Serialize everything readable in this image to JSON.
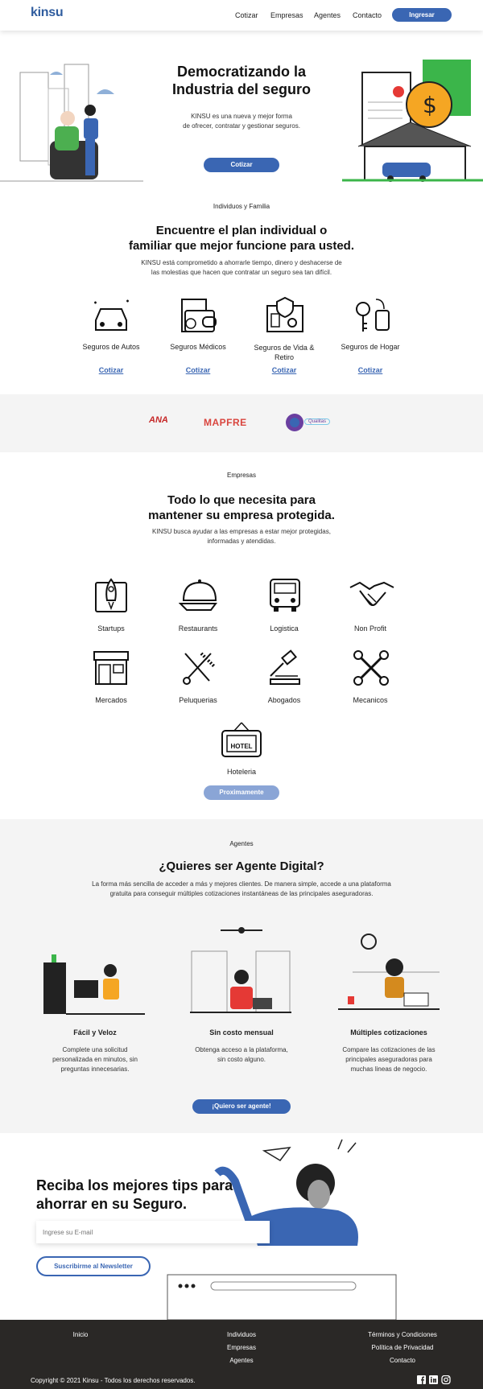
{
  "nav": {
    "logo": "kinsu",
    "links": [
      "Cotizar",
      "Empresas",
      "Agentes",
      "Contacto"
    ],
    "login": "Ingresar"
  },
  "hero": {
    "title_line1": "Democratizando la",
    "title_line2": "Industria del seguro",
    "text_line1": "KINSU es una nueva y mejor forma",
    "text_line2": "de ofrecer, contratar y gestionar seguros.",
    "cta": "Cotizar"
  },
  "individuals": {
    "eyebrow": "Individuos y Familia",
    "title_line1": "Encuentre el plan individual o",
    "title_line2": "familiar que mejor funcione para usted.",
    "text_line1": "KINSU está comprometido a ahorrarle tiempo, dinero y deshacerse de",
    "text_line2": "las molestias que hacen que contratar un seguro sea tan difícil.",
    "items": [
      {
        "label": "Seguros de Autos",
        "link": "Cotizar"
      },
      {
        "label": "Seguros Médicos",
        "link": "Cotizar"
      },
      {
        "label_line1": "Seguros de Vida &",
        "label_line2": "Retiro",
        "link": "Cotizar"
      },
      {
        "label": "Seguros de Hogar",
        "link": "Cotizar"
      }
    ]
  },
  "partners": [
    "ANA",
    "MAPFRE",
    "Qualitas"
  ],
  "business": {
    "eyebrow": "Empresas",
    "title_line1": "Todo lo que necesita para",
    "title_line2": "mantener su empresa protegida.",
    "text_line1": "KINSU busca ayudar a las empresas a estar mejor protegidas,",
    "text_line2": "informadas y atendidas.",
    "items": [
      "Startups",
      "Restaurants",
      "Logistica",
      "Non Profit",
      "Mercados",
      "Peluquerias",
      "Abogados",
      "Mecanicos",
      "Hoteleria"
    ],
    "hotel_sign": "HOTEL",
    "cta": "Proximamente"
  },
  "agents": {
    "eyebrow": "Agentes",
    "title": "¿Quieres ser Agente Digital?",
    "text_line1": "La forma más sencilla de acceder a más y mejores clientes. De manera simple, accede a una plataforma",
    "text_line2": "gratuita para conseguir múltiples cotizaciones instantáneas de las principales aseguradoras.",
    "features": [
      {
        "title": "Fácil y Veloz",
        "l1": "Complete una solicitud",
        "l2": "personalizada en minutos, sin",
        "l3": "preguntas innecesarias."
      },
      {
        "title": "Sin costo mensual",
        "l1": "Obtenga acceso a la plataforma,",
        "l2": "sin costo alguno.",
        "l3": ""
      },
      {
        "title": "Múltiples cotizaciones",
        "l1": "Compare las cotizaciones de las",
        "l2": "principales aseguradoras para",
        "l3": "muchas lineas de negocio."
      }
    ],
    "cta": "¡Quiero ser agente!"
  },
  "newsletter": {
    "title_line1": "Reciba los mejores tips para",
    "title_line2": "ahorrar en su Seguro.",
    "placeholder": "Ingrese su E-mail",
    "cta": "Suscribirme al Newsletter"
  },
  "footer": {
    "col1": [
      "Inicio"
    ],
    "col2": [
      "Individuos",
      "Empresas",
      "Agentes"
    ],
    "col3": [
      "Términos y Condiciones",
      "Política de Privacidad",
      "Contacto"
    ],
    "copyright": "Copyright © 2021 Kinsu - Todos los derechos reservados."
  },
  "colors": {
    "accent": "#3a66b3",
    "footer": "#2a2826",
    "section_grey": "#f4f4f4"
  }
}
